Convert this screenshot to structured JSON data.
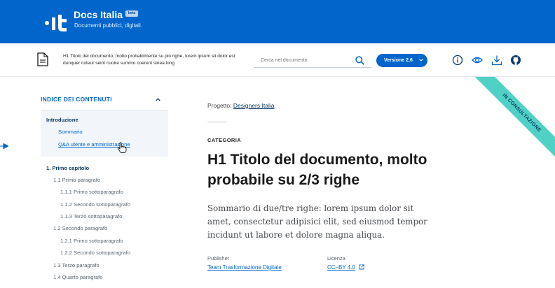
{
  "brand": {
    "title": "Docs Italia",
    "badge": "beta",
    "subtitle": "Documenti pubblici, digitali."
  },
  "docbar": {
    "title": "H1 Titolo del documento, molto probabilmente su più righe, lorem ipsum sit dolor est dunquer coteur seint cuoire summo coerent sinea long",
    "search_placeholder": "Cerca nel documento",
    "version_label": "Versione 2.6"
  },
  "sidebar": {
    "heading": "INDICE DEI CONTENUTI",
    "intro": {
      "title": "Introduzione",
      "items": [
        "Sommario",
        "Q&A utente e amministrazione"
      ]
    },
    "chapter": {
      "title": "1. Primo capitolo",
      "items": [
        "1.1 Primo paragrafo",
        "1.1.1 Primo sottoparagrafo",
        "1.1.2 Secondo sottoparagrafo",
        "1.1.3 Terzo sottoparagrafo",
        "1.2 Secondo paragrafo",
        "1.2.1 Primo sottoparagrafo",
        "1.2.2 Secondo sottoparagrafo",
        "1.3 Terzo paragrafo",
        "1.4 Quarto paragrafo"
      ]
    }
  },
  "main": {
    "project_label": "Progetto:",
    "project_link": "Designers Italia",
    "category": "CATEGORIA",
    "title": "H1 Titolo del documento, molto probabile su 2/3 righe",
    "summary": "Sommario di due/tre righe: lorem ipsum dolor sit amet, consectetur adipisici elit, sed eiusmod tempor incidunt ut labore et dolore magna aliqua.",
    "publisher_label": "Publisher",
    "publisher_link": "Team Trasformazione Digitale",
    "license_label": "Licenza",
    "license_link": "CC–BY 4.0"
  },
  "ribbon": {
    "label": "IN CONSULTAZIONE"
  },
  "icons": [
    "document-icon",
    "search-icon",
    "chevron-down-icon",
    "info-icon",
    "eye-icon",
    "download-icon",
    "github-icon",
    "chevron-up-icon",
    "hand-cursor-icon",
    "external-link-icon",
    "arrow-right-icon"
  ],
  "colors": {
    "primary": "#0066cc",
    "ribbon": "#4fd1c5",
    "sidebar_highlight": "#f2f6fa"
  }
}
